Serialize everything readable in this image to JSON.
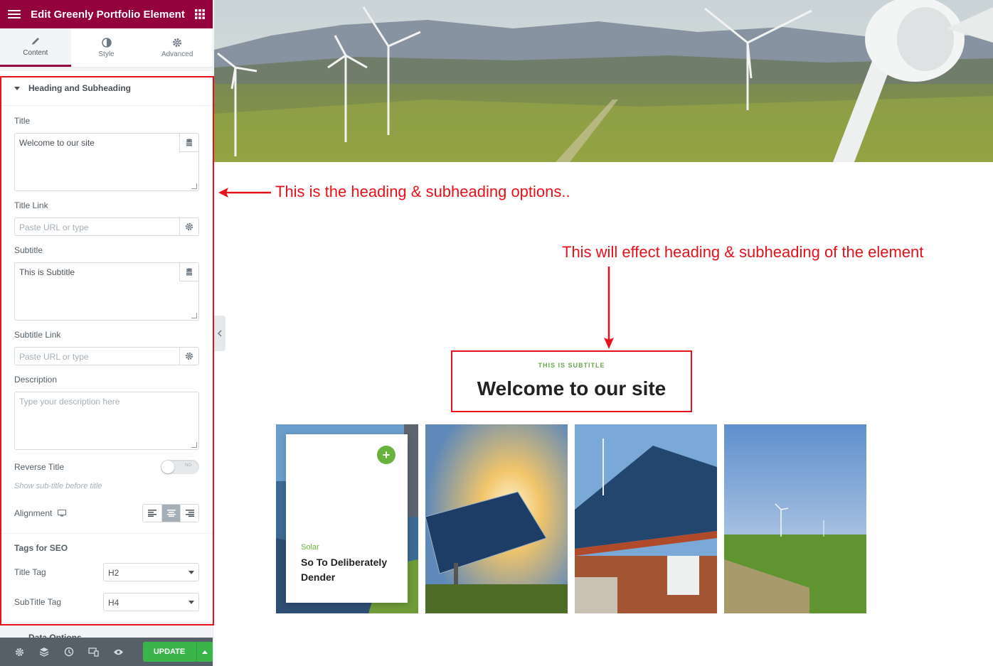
{
  "panel": {
    "title": "Edit Greenly Portfolio Element",
    "tabs": [
      {
        "label": "Content",
        "icon": "pencil-icon",
        "active": true
      },
      {
        "label": "Style",
        "icon": "contrast-icon",
        "active": false
      },
      {
        "label": "Advanced",
        "icon": "gear-icon",
        "active": false
      }
    ],
    "section_title": "Heading and Subheading",
    "title_label": "Title",
    "title_value": "Welcome to our site",
    "title_link_label": "Title Link",
    "title_link_placeholder": "Paste URL or type",
    "subtitle_label": "Subtitle",
    "subtitle_value": "This is Subtitle",
    "subtitle_link_label": "Subtitle Link",
    "subtitle_link_placeholder": "Paste URL or type",
    "description_label": "Description",
    "description_placeholder": "Type your description here",
    "reverse_label": "Reverse Title",
    "reverse_switch": "NO",
    "reverse_hint": "Show sub-title before title",
    "alignment_label": "Alignment",
    "alignment_selected": "center",
    "seo_heading": "Tags for SEO",
    "title_tag_label": "Title Tag",
    "title_tag_value": "H2",
    "subtitle_tag_label": "SubTitle Tag",
    "subtitle_tag_value": "H4",
    "next_section_partial": "Data Options",
    "update_label": "UPDATE"
  },
  "annotations": {
    "panel_note": "This is the heading & subheading options..",
    "preview_note": "This will effect heading & subheading of the element"
  },
  "preview": {
    "subtitle": "THIS IS SUBTITLE",
    "title": "Welcome to our site",
    "card": {
      "category": "Solar",
      "title": "So To Deliberately Dender"
    }
  },
  "colors": {
    "brand": "#93003c",
    "accent": "#6ab23e",
    "annotation": "#e8111a",
    "update": "#39b54a"
  }
}
